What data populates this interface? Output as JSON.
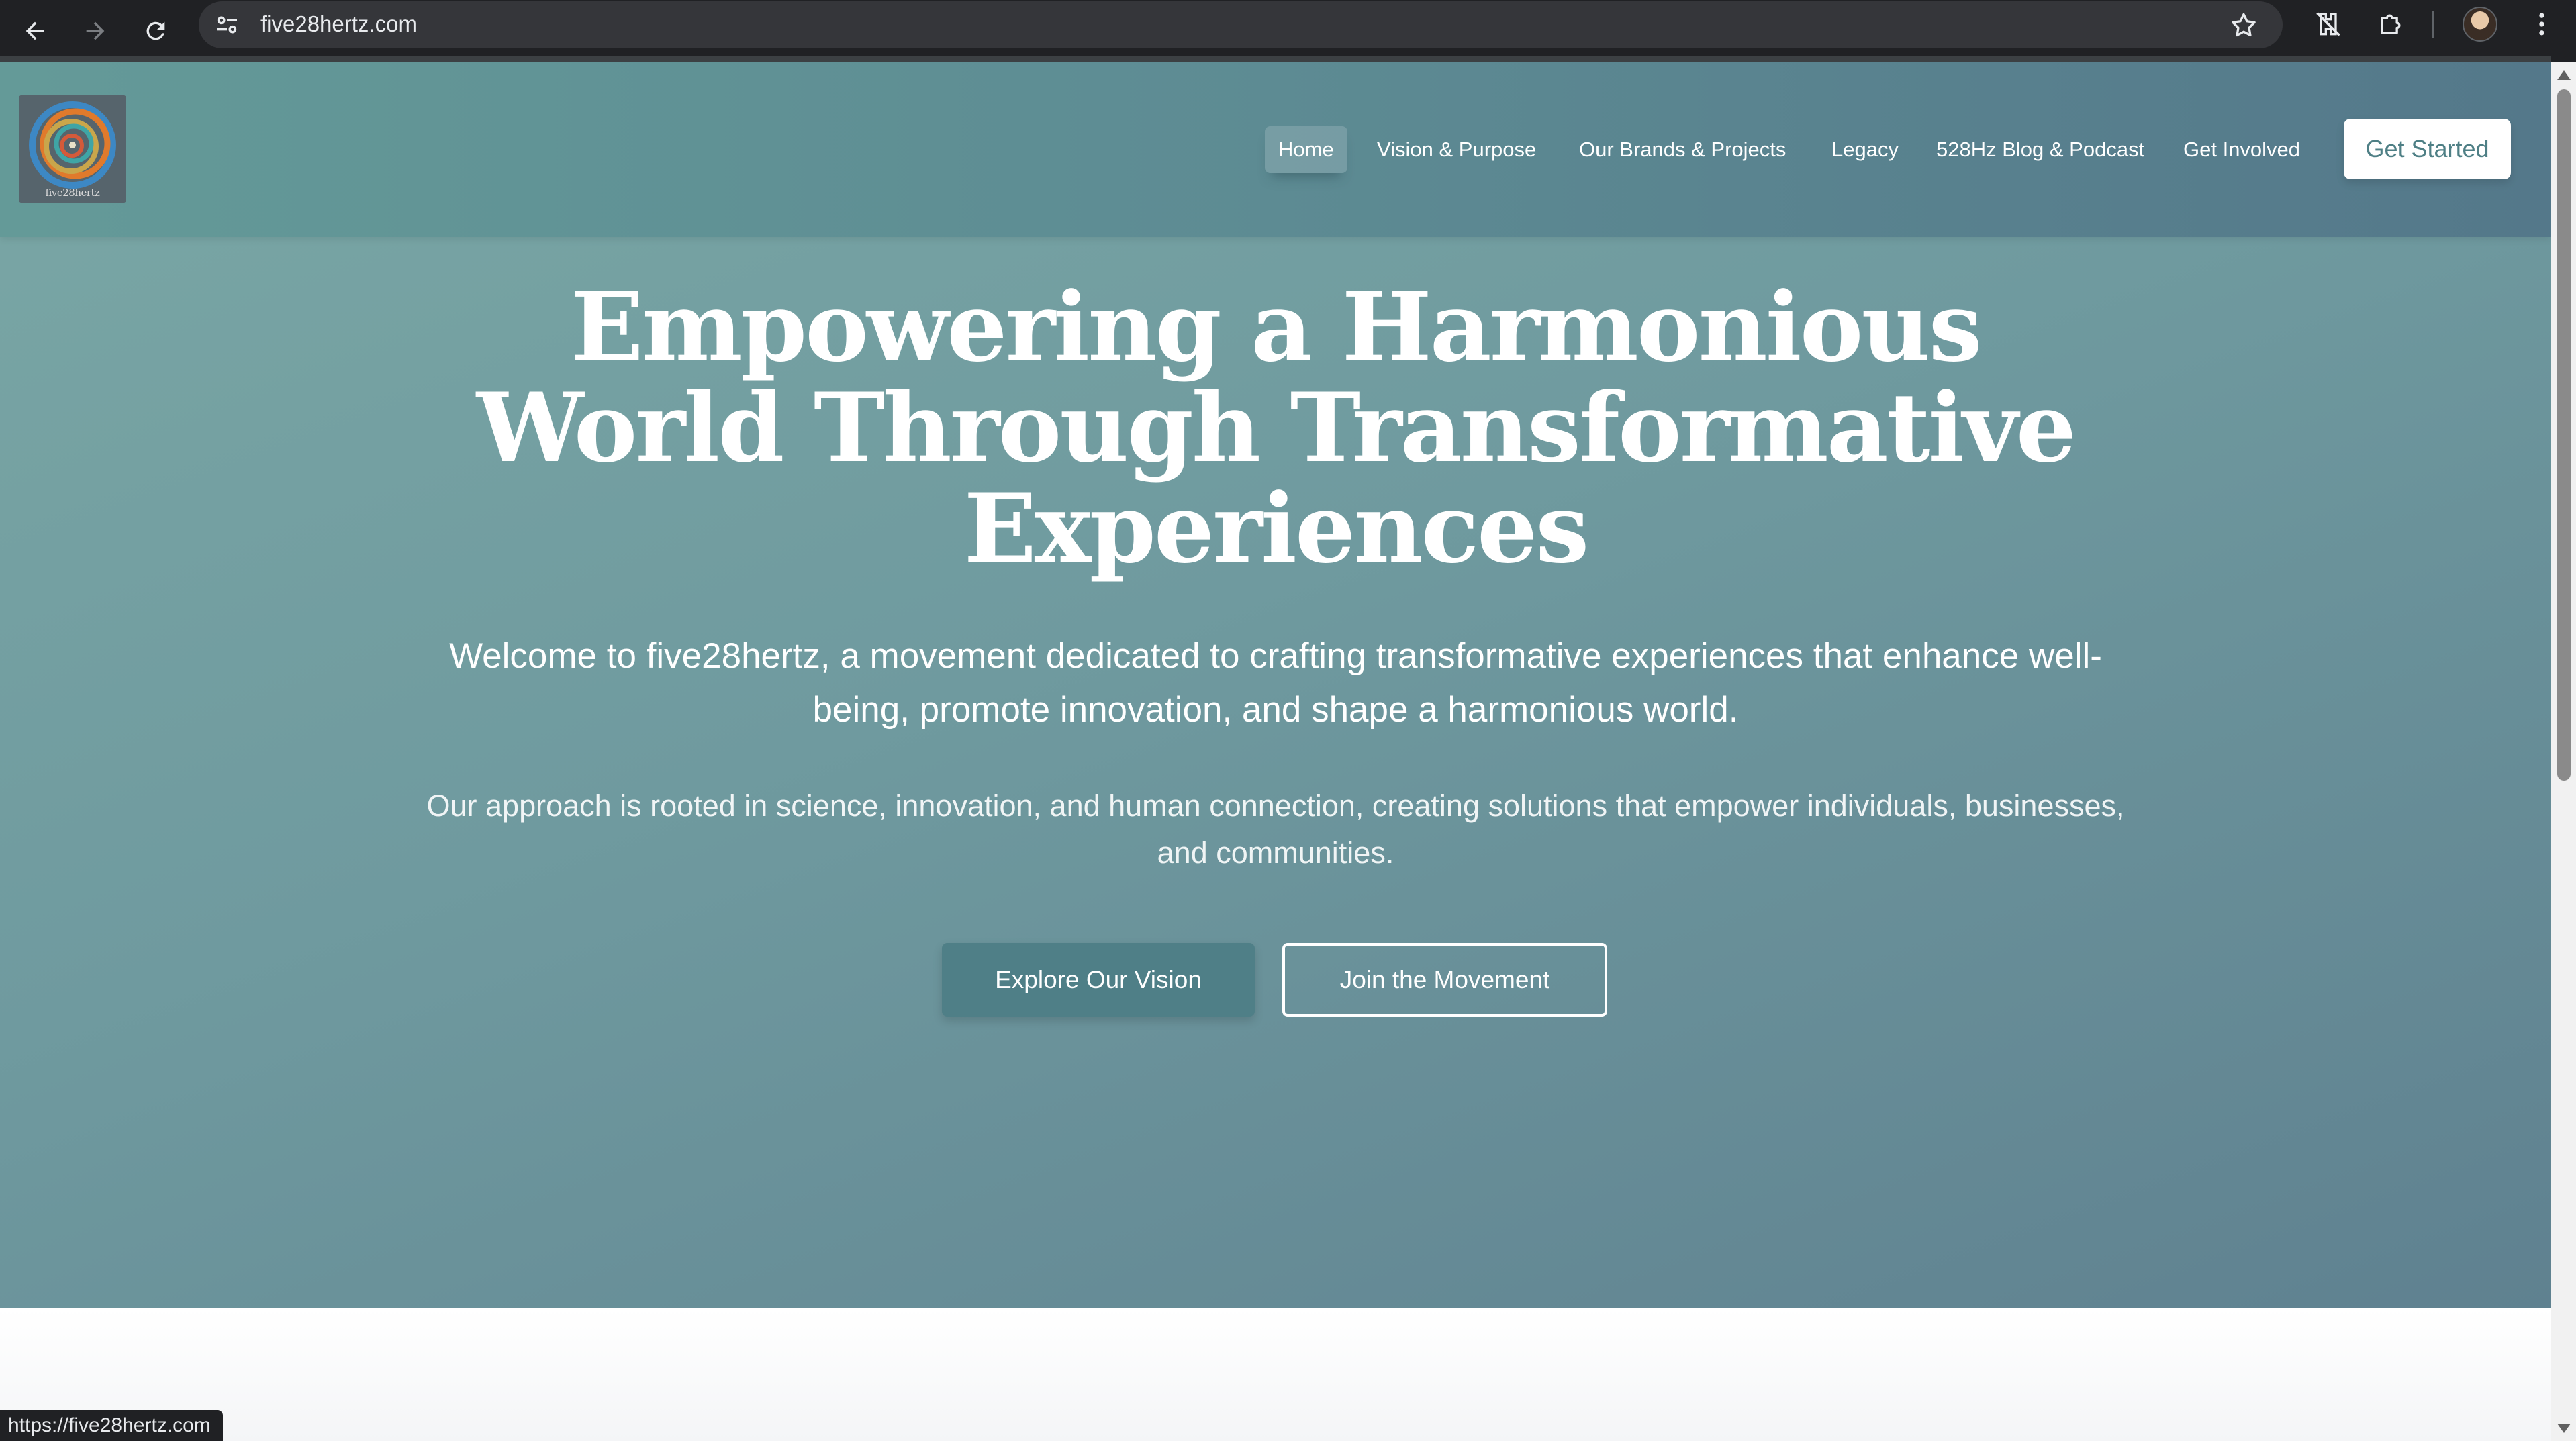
{
  "browser": {
    "url": "five28hertz.com",
    "status_url": "https://five28hertz.com"
  },
  "header": {
    "logo_text": "five28hertz",
    "nav": [
      {
        "label": "Home",
        "active": true
      },
      {
        "label": "Vision & Purpose"
      },
      {
        "label": "Our Brands & Projects"
      },
      {
        "label": "Legacy"
      },
      {
        "label": "528Hz Blog & Podcast"
      },
      {
        "label": "Get Involved"
      }
    ],
    "cta_label": "Get Started"
  },
  "hero": {
    "headline_lines": [
      "Empowering a Harmonious",
      "World Through Transformative",
      "Experiences"
    ],
    "lead": "Welcome to five28hertz, a movement dedicated to crafting transformative experiences that enhance well-being, promote innovation, and shape a harmonious world.",
    "sub": "Our approach is rooted in science, innovation, and human connection, creating solutions that empower individuals, businesses, and communities.",
    "primary_button": "Explore Our Vision",
    "secondary_button": "Join the Movement"
  },
  "colors": {
    "hero_gradient_start": "#7aa7a5",
    "hero_gradient_end": "#5f8190",
    "primary_button": "#4f7f87",
    "chrome": "#202124"
  }
}
